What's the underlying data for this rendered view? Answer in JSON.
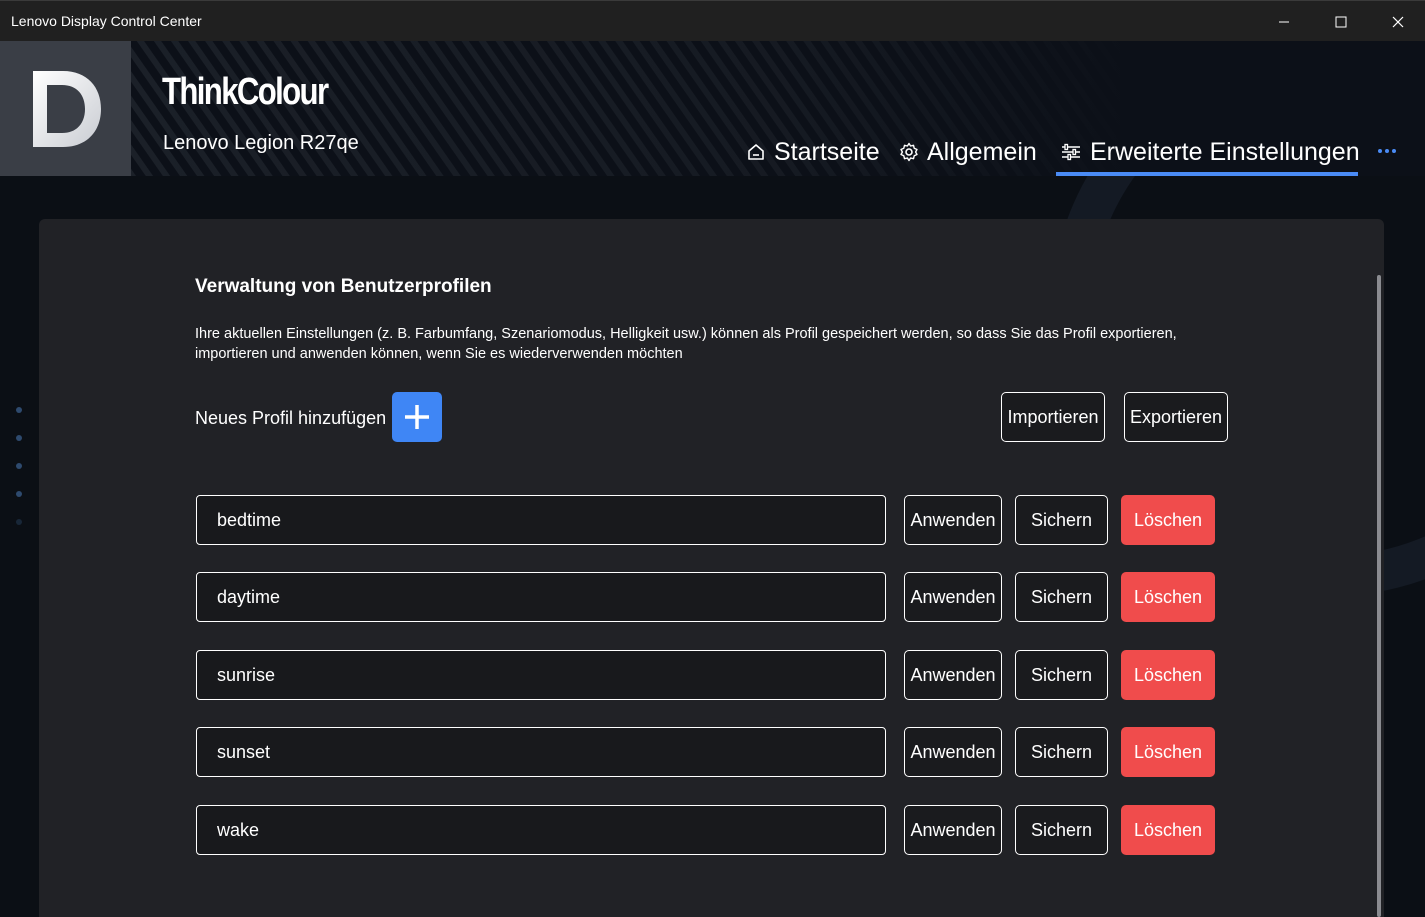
{
  "window": {
    "title": "Lenovo Display Control Center"
  },
  "header": {
    "brand": "ThinkColour",
    "model": "Lenovo Legion R27qe",
    "logo_icon": "d-logo-icon"
  },
  "nav": {
    "tabs": [
      {
        "label": "Startseite",
        "icon": "home-icon"
      },
      {
        "label": "Allgemein",
        "icon": "gear-icon"
      },
      {
        "label": "Erweiterte Einstellungen",
        "icon": "sliders-icon",
        "active": true
      }
    ],
    "more_icon": "more-icon"
  },
  "colors": {
    "accent": "#4a8bf5",
    "add_button": "#3f86f5",
    "delete_button": "#f04c4c",
    "panel": "#212226"
  },
  "profiles_section": {
    "title": "Verwaltung von Benutzerprofilen",
    "description": "Ihre aktuellen Einstellungen (z. B. Farbumfang, Szenariomodus, Helligkeit usw.) können als Profil gespeichert werden, so dass Sie das Profil exportieren, importieren und anwenden können, wenn Sie es wiederverwenden möchten",
    "add_label": "Neues Profil hinzufügen",
    "import_label": "Importieren",
    "export_label": "Exportieren",
    "apply_label": "Anwenden",
    "save_label": "Sichern",
    "delete_label": "Löschen",
    "profiles": [
      {
        "name": "bedtime"
      },
      {
        "name": "daytime"
      },
      {
        "name": "sunrise"
      },
      {
        "name": "sunset"
      },
      {
        "name": "wake"
      }
    ]
  }
}
